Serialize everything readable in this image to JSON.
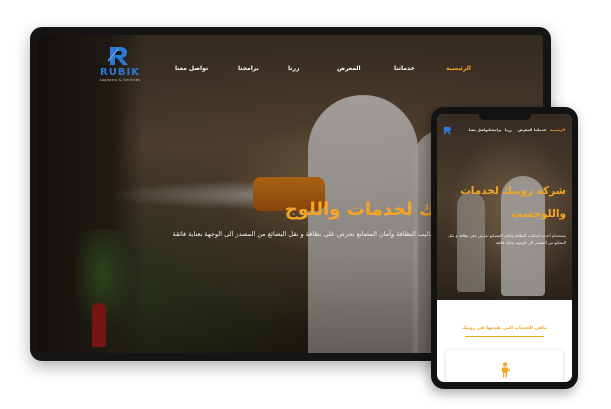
{
  "site": {
    "logo": {
      "word": "RUBIK",
      "tagline": "Logistics & Services"
    },
    "nav": [
      {
        "label": "الرئيسية",
        "active": true
      },
      {
        "label": "خدماتنا",
        "active": false
      },
      {
        "label": "المعرض",
        "active": false
      },
      {
        "label": "زرنا",
        "active": false
      },
      {
        "label": "برامجنا",
        "active": false
      },
      {
        "label": "تواصل معنا",
        "active": false
      }
    ],
    "hero": {
      "title_desktop": "بيك لخدمات واللوج",
      "desc_desktop": "حث أساليب النظافة وأمان المصانع نحرص على نظافة و نقل البضائع من المصدر الى الوجهة بعناية فائقة",
      "title_mobile": "شركة روبيك لخدمات واللوجست",
      "desc_mobile": "بستخدام أحدث أساليب النظافة وأمان المصانع نحرص على نظافة و نقل البضائع من المصدر الى الوجهة بعناية فائقة"
    },
    "services_title": "ماهي الخدمات التي نقدمها في روبيك"
  },
  "colors": {
    "accent": "#f5a623",
    "logo_blue": "#2e79d6",
    "device_frame": "#151515"
  },
  "icons": {
    "logo": "rubik-logo-icon",
    "service": "worker-icon"
  }
}
